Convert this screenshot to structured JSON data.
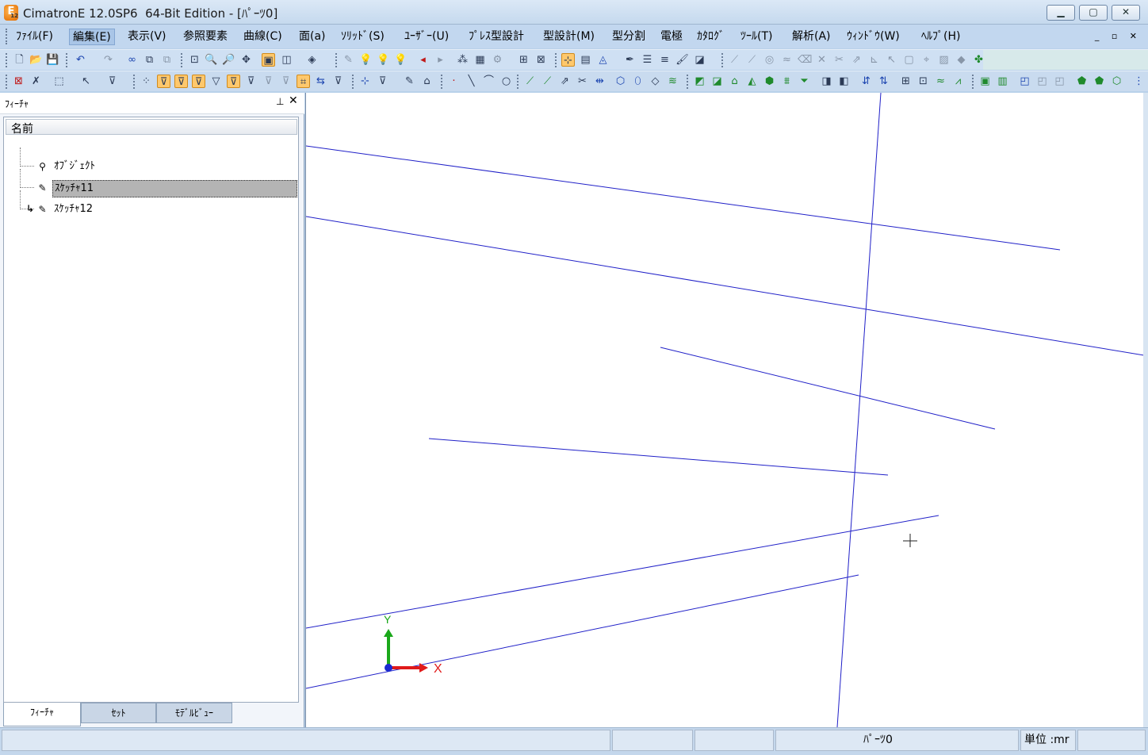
{
  "window": {
    "logo_letter": "E",
    "logo_sub": "12",
    "title": "CimatronE 12.0SP6  64-Bit Edition - [ﾊﾟｰﾂ0]",
    "min_icon": "▁",
    "max_icon": "▢",
    "close_icon": "✕"
  },
  "menu": {
    "items": [
      "ﾌｧｲﾙ(F)",
      "編集(E)",
      "表示(V)",
      "参照要素",
      "曲線(C)",
      "面(a)",
      "ｿﾘｯﾄﾞ(S)",
      "ﾕｰｻﾞｰ(U)",
      "ﾌﾟﾚｽ型設計",
      "型設計(M)",
      "型分割",
      "電極",
      "ｶﾀﾛｸﾞ",
      "ﾂｰﾙ(T)",
      "解析(A)",
      "ｳｨﾝﾄﾞｳ(W)",
      "ﾍﾙﾌﾟ(H)"
    ],
    "active_index": 1,
    "mdi_controls": "_ ▫ ✕"
  },
  "panel": {
    "title": "ﾌｨｰﾁｬ",
    "pin_icon": "⊥",
    "close_icon": "✕",
    "column_header": "名前",
    "tree": [
      {
        "label": "ｵﾌﾞｼﾞｪｸﾄ",
        "icon": "object-icon",
        "glyph": "⚲"
      },
      {
        "label": "ｽｹｯﾁｬ11",
        "icon": "sketch-icon",
        "glyph": "✎",
        "selected": true
      },
      {
        "label": "ｽｹｯﾁｬ12",
        "icon": "sketch-icon",
        "glyph": "✎",
        "arrow": "↳"
      }
    ],
    "tabs": [
      {
        "label": "ﾌｨｰﾁｬ",
        "active": true
      },
      {
        "label": "ｾｯﾄ"
      },
      {
        "label": "ﾓﾃﾞﾙﾋﾞｭｰ"
      }
    ]
  },
  "viewport": {
    "line_color": "#2020c8",
    "axis": {
      "x_label": "X",
      "y_label": "Y",
      "x_color": "#e01a1a",
      "y_color": "#1aa81a",
      "origin_color": "#1a2ad0"
    },
    "cursor": "+"
  },
  "status": {
    "part": "ﾊﾟｰﾂ0",
    "unit": "単位 :mr"
  }
}
